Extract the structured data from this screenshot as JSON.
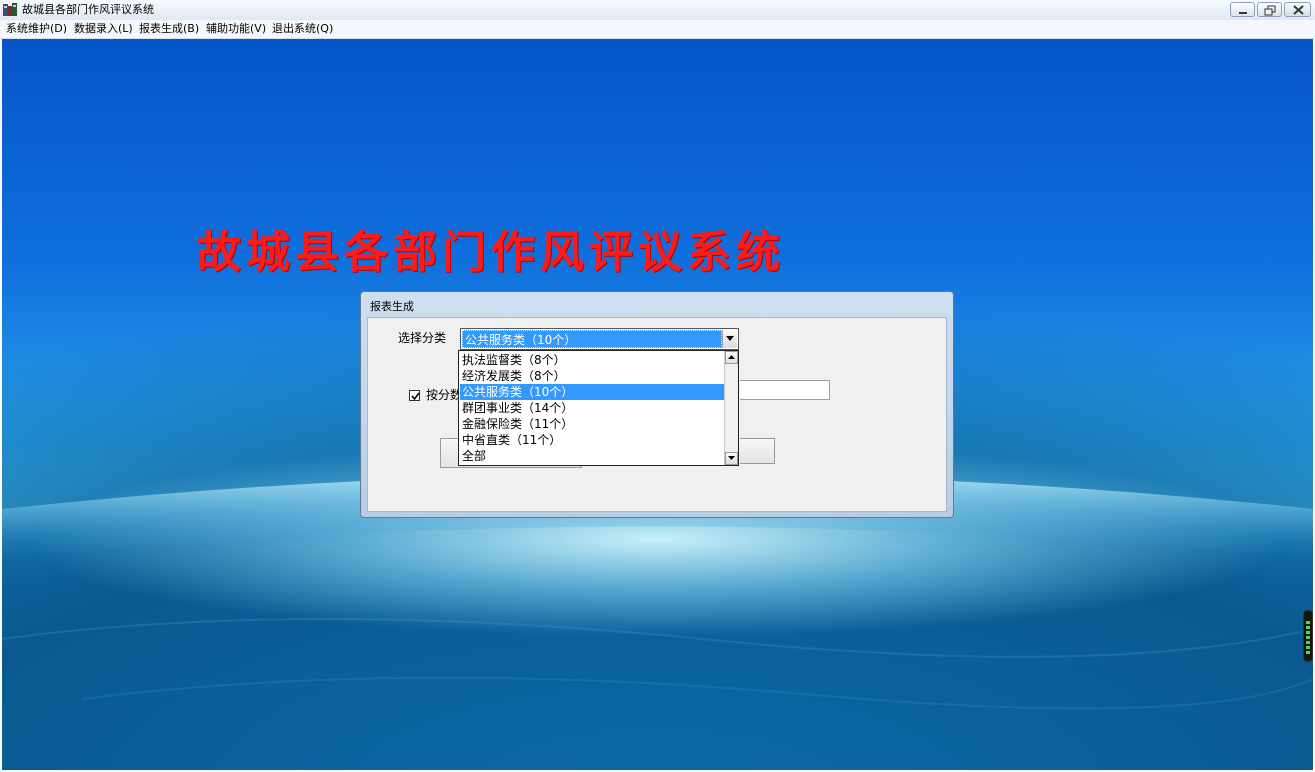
{
  "window": {
    "title": "故城县各部门作风评议系统"
  },
  "menu": [
    {
      "label": "系统维护(D)"
    },
    {
      "label": "数据录入(L)"
    },
    {
      "label": "报表生成(B)"
    },
    {
      "label": "辅助功能(V)"
    },
    {
      "label": "退出系统(Q)"
    }
  ],
  "banner": {
    "text": "故城县各部门作风评议系统",
    "color": "#ff1a1a"
  },
  "dialog": {
    "title": "报表生成",
    "category_label": "选择分类",
    "category_value": "公共服务类（10个）",
    "by_score_label": "按分数",
    "by_score_checked": true,
    "dropdown_options": [
      "执法监督类（8个）",
      "经济发展类（8个）",
      "公共服务类（10个）",
      "群团事业类（14个）",
      "金融保险类（11个）",
      "中省直类（11个）",
      "全部"
    ],
    "selected_index": 2
  },
  "colors": {
    "selection": "#3399ff",
    "desktop_top": "#0755c8",
    "desktop_glow": "#46c0f2"
  }
}
